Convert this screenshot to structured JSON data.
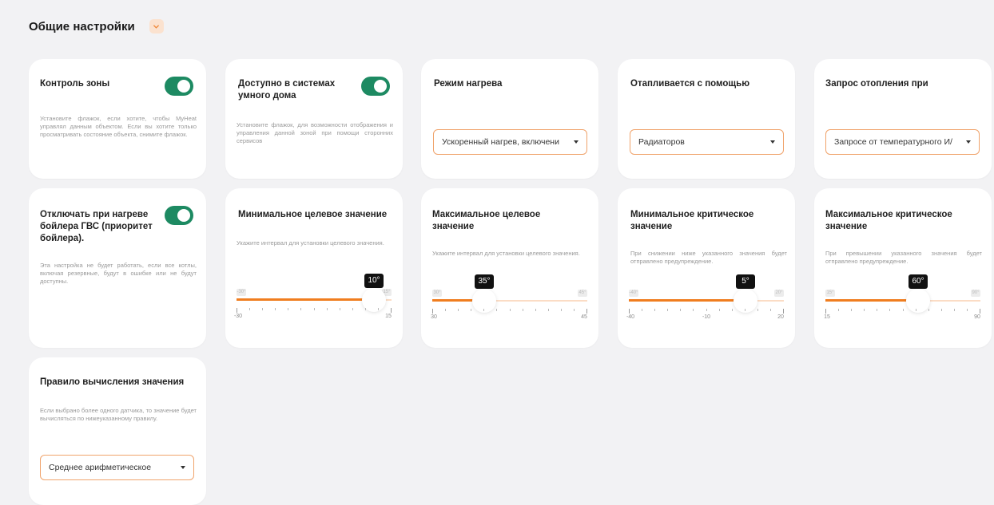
{
  "header": {
    "title": "Общие настройки"
  },
  "cards": {
    "zone_control": {
      "title": "Контроль зоны",
      "desc": "Установите флажок, если хотите, чтобы MyHeat управлял данным объектом. Если вы хотите только просматривать состояние объекта, снимите флажок.",
      "toggle": true
    },
    "smart_home": {
      "title": "Доступно в системах умного дома",
      "desc": "Установите флажок, для возможности отображения и управления данной зоной при помощи сторонних сервисов",
      "toggle": true
    },
    "heating_mode": {
      "title": "Режим нагрева",
      "select": "Ускоренный нагрев, включени"
    },
    "heated_by": {
      "title": "Отапливается с помощью",
      "select": "Радиаторов"
    },
    "heat_request": {
      "title": "Запрос отопления при",
      "select": "Запросе от температурного И/"
    },
    "boiler_priority": {
      "title": "Отключать при нагреве бойлера ГВС (приоритет бойлера).",
      "desc": "Эта настройка не будет работать, если все котлы, включая резервные, будут в ошибке или не будут доступны.",
      "toggle": true
    },
    "min_target": {
      "title": "Минимальное целевое значение",
      "desc": "Укажите интервал для установки целевого значения.",
      "value_label": "10°",
      "value": 10,
      "min": -30,
      "max": 15,
      "min_label": "-30",
      "max_label": "15",
      "min_badge": "-30°",
      "max_badge": "15°"
    },
    "max_target": {
      "title": "Максимальное целевое значение",
      "desc": "Укажите интервал для установки целевого значения.",
      "value_label": "35°",
      "value": 35,
      "min": 30,
      "max": 45,
      "min_label": "30",
      "max_label": "45",
      "min_badge": "30°",
      "max_badge": "45°"
    },
    "min_critical": {
      "title": "Минимальное критическое значение",
      "desc": "При снижении ниже указанного значения будет отправлено предупреждение.",
      "value_label": "5°",
      "value": 5,
      "min": -40,
      "max": 20,
      "min_label": "-40",
      "mid_label": "-10",
      "max_label": "20",
      "min_badge": "-40°",
      "max_badge": "20°"
    },
    "max_critical": {
      "title": "Максимальное критическое значение",
      "desc": "При превышении указанного значения будет отправлено предупреждение.",
      "value_label": "60°",
      "value": 60,
      "min": 15,
      "max": 90,
      "min_label": "15",
      "max_label": "90",
      "min_badge": "15°",
      "max_badge": "90°"
    },
    "calc_rule": {
      "title": "Правило вычисления значения",
      "desc": "Если выбрано более одного датчика, то значение будет вычисляться по нижеуказанному правилу.",
      "select": "Среднее арифметическое"
    }
  },
  "colors": {
    "accent": "#f07d1f",
    "toggle_on": "#1d8a62",
    "select_border": "#f0a36b",
    "background": "#f2f2f4"
  },
  "icons": {
    "collapse": "chevron-down-icon",
    "dropdown": "caret-down-icon"
  }
}
